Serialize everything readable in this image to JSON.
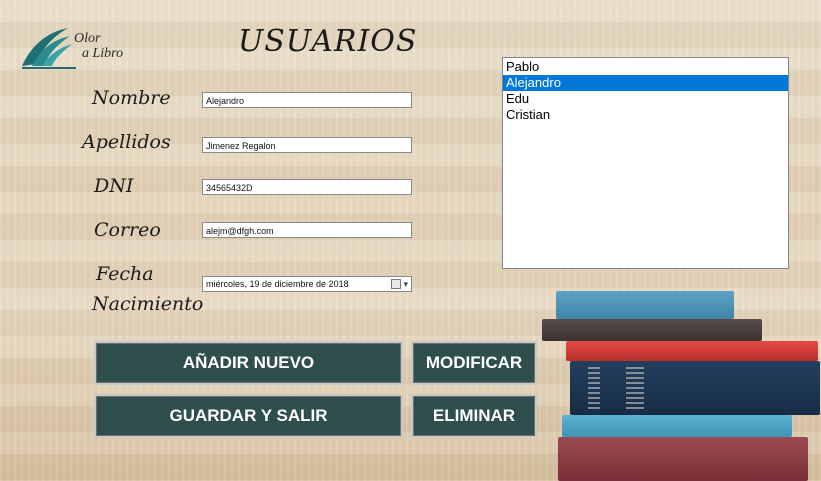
{
  "logo": {
    "line1": "Olor",
    "line2": "a Libro"
  },
  "page_title": "USUARIOS",
  "form": {
    "nombre": {
      "label": "Nombre",
      "value": "Alejandro"
    },
    "apellidos": {
      "label": "Apellidos",
      "value": "Jimenez Regalon"
    },
    "dni": {
      "label": "DNI",
      "value": "34565432D"
    },
    "correo": {
      "label": "Correo",
      "value": "alejm@dfgh.com"
    },
    "fecha": {
      "label_line1": "Fecha",
      "label_line2": "Nacimiento",
      "value": "miércoles, 19 de  diciembre  de 2018"
    }
  },
  "users_list": {
    "items": [
      "Pablo",
      "Alejandro",
      "Edu",
      "Cristian"
    ],
    "selected": "Alejandro"
  },
  "buttons": {
    "add": "AÑADIR NUEVO",
    "modify": "MODIFICAR",
    "save_exit": "GUARDAR Y SALIR",
    "delete": "ELIMINAR"
  },
  "colors": {
    "button_bg": "#2e4f4b",
    "button_text": "#ffffff",
    "selection": "#0078d7",
    "logo_teal": "#1f6f73"
  }
}
